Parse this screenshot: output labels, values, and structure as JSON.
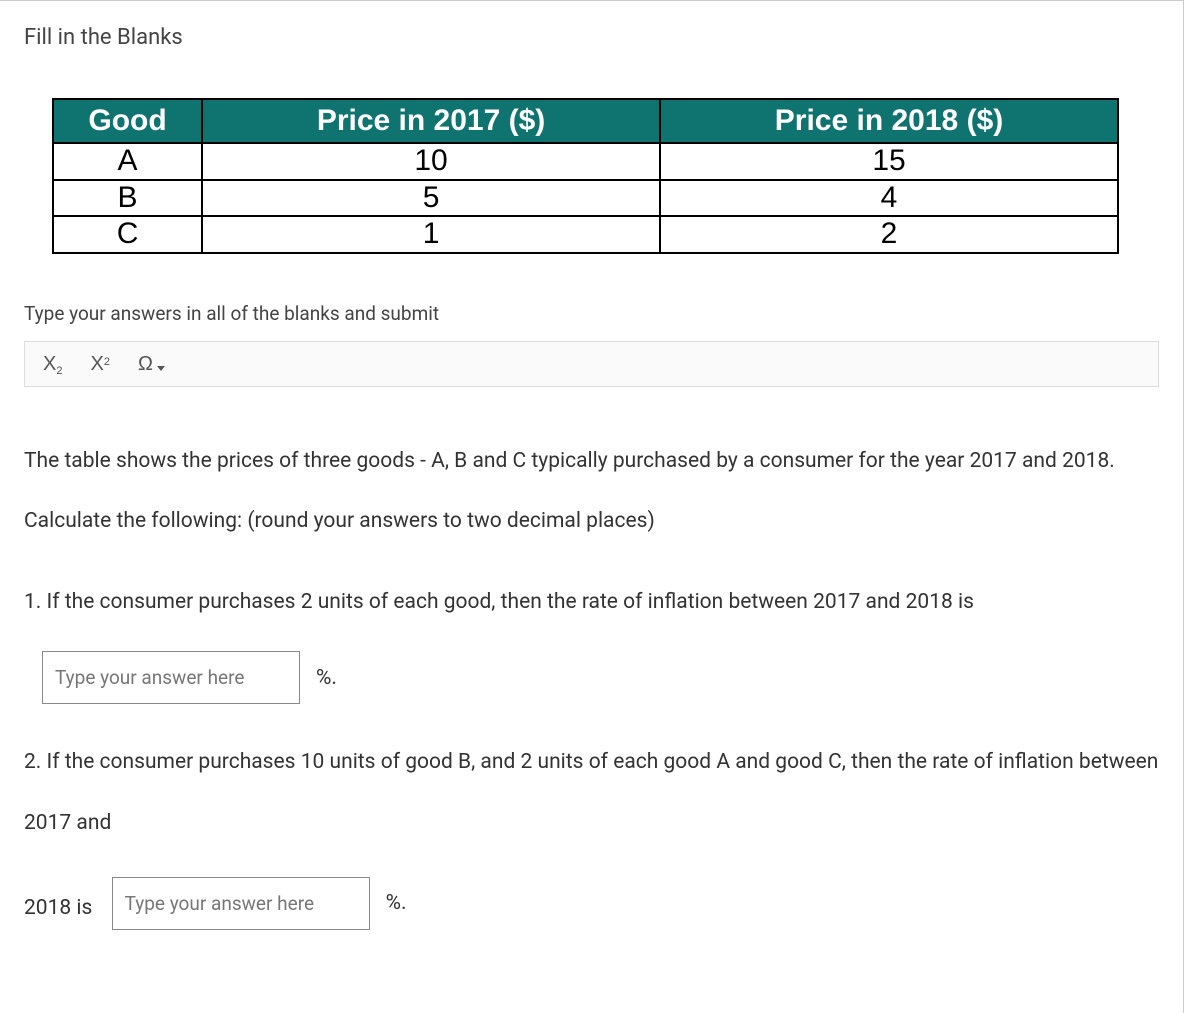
{
  "title": "Fill in the Blanks",
  "table": {
    "headers": [
      "Good",
      "Price in 2017 ($)",
      "Price in 2018 ($)"
    ],
    "rows": [
      {
        "good": "A",
        "p2017": "10",
        "p2018": "15"
      },
      {
        "good": "B",
        "p2017": "5",
        "p2018": "4"
      },
      {
        "good": "C",
        "p2017": "1",
        "p2018": "2"
      }
    ]
  },
  "instruction": "Type your answers in all of the blanks and submit",
  "toolbar": {
    "subscript": "X",
    "subscript_sub": "2",
    "superscript": "X",
    "superscript_sup": "2",
    "omega": "Ω"
  },
  "body_text": "The table shows the prices of three goods - A, B and C typically purchased by a consumer for the year 2017 and 2018. Calculate the following: (round your answers to two decimal places)",
  "question1": {
    "text": "1. If the consumer purchases 2 units of each good, then the rate of inflation between 2017 and 2018 is",
    "placeholder": "Type your answer here",
    "unit": "%."
  },
  "question2": {
    "text": "2. If the consumer purchases 10 units of good B, and 2 units of each good A and good C, then the rate of inflation between 2017 and",
    "prefix": "2018 is",
    "placeholder": "Type your answer here",
    "unit": "%."
  }
}
